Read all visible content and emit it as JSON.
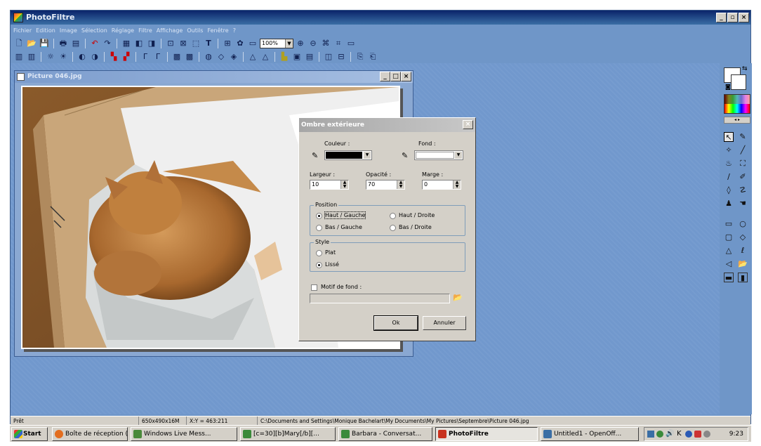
{
  "app": {
    "title": "PhotoFiltre",
    "menu": [
      "Fichier",
      "Edition",
      "Image",
      "Sélection",
      "Réglage",
      "Filtre",
      "Affichage",
      "Outils",
      "Fenêtre",
      "?"
    ],
    "zoom": "100%"
  },
  "picture_window": {
    "title": "Picture 046.jpg"
  },
  "dialog": {
    "title": "Ombre extérieure",
    "couleur_label": "Couleur :",
    "fond_label": "Fond :",
    "couleur_value": "#000000",
    "fond_value": "#ffffff",
    "largeur_label": "Largeur :",
    "largeur_value": "10",
    "opacite_label": "Opacité :",
    "opacite_value": "70",
    "marge_label": "Marge :",
    "marge_value": "0",
    "position_label": "Position",
    "position_options": [
      "Haut / Gauche",
      "Haut / Droite",
      "Bas / Gauche",
      "Bas / Droite"
    ],
    "position_selected": "Haut / Gauche",
    "style_label": "Style",
    "style_options": [
      "Plat",
      "Lissé"
    ],
    "style_selected": "Lissé",
    "motif_label": "Motif de fond :",
    "ok_label": "Ok",
    "cancel_label": "Annuler"
  },
  "status": {
    "state": "Prêt",
    "size": "650x490x16M",
    "coords": "X:Y = 463:211",
    "path": "C:\\Documents and Settings\\Monique Bachelart\\My Documents\\My Pictures\\Septembre\\Picture 046.jpg"
  },
  "taskbar": {
    "start": "Start",
    "tasks": [
      {
        "label": "Boîte de réception (...",
        "icon": "mail-icon",
        "color": "#e36d1e"
      },
      {
        "label": "Windows Live Mess...",
        "icon": "messenger-icon",
        "color": "#4a8a3a"
      },
      {
        "label": "[c=30][b]Mary[/b][...",
        "icon": "chat-icon",
        "color": "#3a8a3a"
      },
      {
        "label": "Barbara - Conversat...",
        "icon": "chat-icon",
        "color": "#3a8a3a"
      },
      {
        "label": "PhotoFiltre",
        "icon": "photofiltre-icon",
        "color": "#c8321e"
      },
      {
        "label": "Untitled1 - OpenOff...",
        "icon": "document-icon",
        "color": "#3a6ea5"
      }
    ],
    "clock": "9:23"
  }
}
